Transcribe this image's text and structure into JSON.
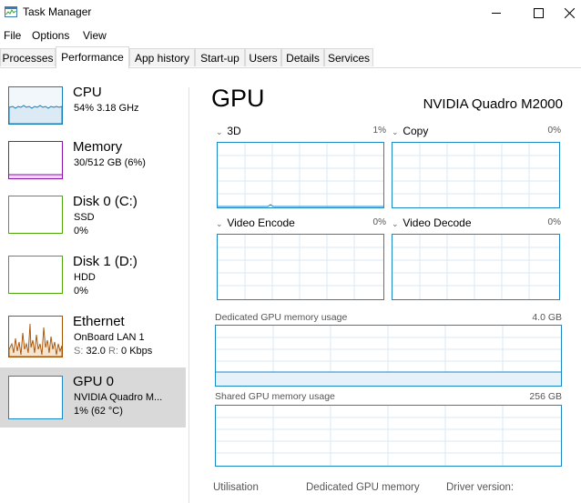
{
  "window": {
    "title": "Task Manager"
  },
  "menu": [
    "File",
    "Options",
    "View"
  ],
  "tabs": [
    "Processes",
    "Performance",
    "App history",
    "Start-up",
    "Users",
    "Details",
    "Services"
  ],
  "sidebar": {
    "items": [
      {
        "title": "CPU",
        "line1": "54% 3.18 GHz",
        "line2": "",
        "color": "#117dbb"
      },
      {
        "title": "Memory",
        "line1": "30/512 GB (6%)",
        "line2": "",
        "color": "#8b12ae"
      },
      {
        "title": "Disk 0 (C:)",
        "line1": "SSD",
        "line2": "0%",
        "color": "#4da60c"
      },
      {
        "title": "Disk 1 (D:)",
        "line1": "HDD",
        "line2": "0%",
        "color": "#4da60c"
      },
      {
        "title": "Ethernet",
        "line1": "OnBoard LAN 1",
        "s_label": "S:",
        "s_value": "32.0",
        "r_label": "R:",
        "r_value": "0 Kbps",
        "color": "#a74f01"
      },
      {
        "title": "GPU 0",
        "line1": "NVIDIA Quadro M...",
        "line2": "1% (62 °C)",
        "color": "#1b87c5"
      }
    ]
  },
  "main": {
    "title": "GPU",
    "gpu_name": "NVIDIA Quadro M2000",
    "engines": [
      {
        "name": "3D",
        "percent": "1%"
      },
      {
        "name": "Copy",
        "percent": "0%"
      },
      {
        "name": "Video Encode",
        "percent": "0%"
      },
      {
        "name": "Video Decode",
        "percent": "0%"
      }
    ],
    "dedicated": {
      "label": "Dedicated GPU memory usage",
      "max": "4.0 GB"
    },
    "shared": {
      "label": "Shared GPU memory usage",
      "max": "256 GB"
    },
    "stats": [
      "Utilisation",
      "Dedicated GPU memory",
      "Driver version:"
    ]
  },
  "colors": {
    "gpu_accent": "#1b87c5",
    "grid": "#d9eaf4"
  }
}
